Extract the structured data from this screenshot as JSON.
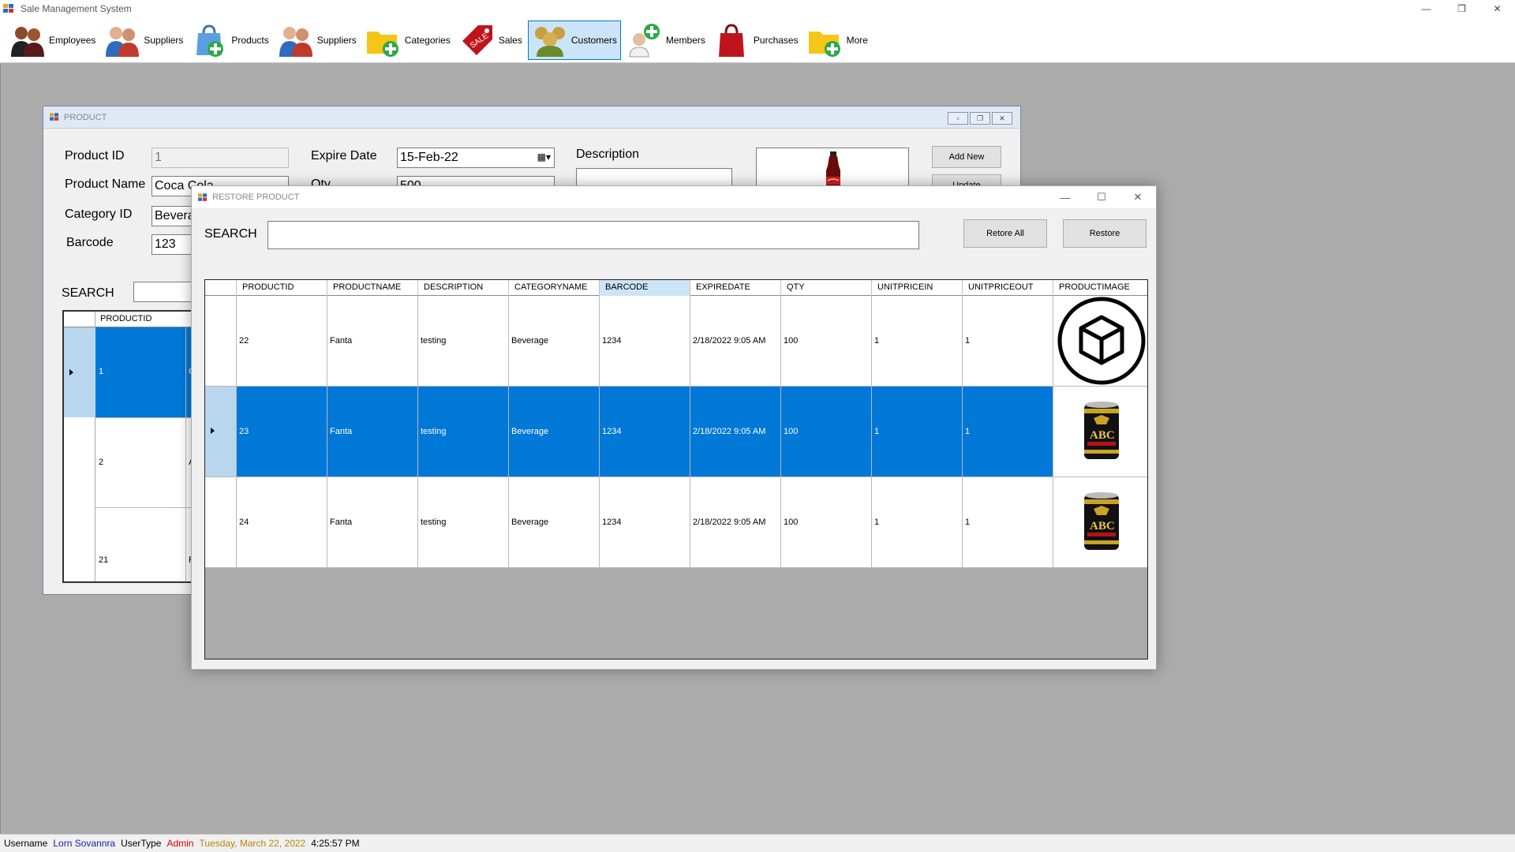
{
  "window": {
    "title": "Sale Management System"
  },
  "toolbar": {
    "items": [
      {
        "label": "Employees",
        "icon": "employees-icon"
      },
      {
        "label": "Suppliers",
        "icon": "suppliers-icon"
      },
      {
        "label": "Products",
        "icon": "products-bag-icon"
      },
      {
        "label": "Suppliers",
        "icon": "suppliers-icon"
      },
      {
        "label": "Categories",
        "icon": "folder-add-icon"
      },
      {
        "label": "Sales",
        "icon": "sale-tag-icon"
      },
      {
        "label": "Customers",
        "icon": "customers-icon",
        "active": true
      },
      {
        "label": "Members",
        "icon": "member-add-icon"
      },
      {
        "label": "Purchases",
        "icon": "shopping-bag-icon"
      },
      {
        "label": "More",
        "icon": "folder-add-icon"
      }
    ]
  },
  "product_form": {
    "title": "PRODUCT",
    "product_id_label": "Product ID",
    "product_id_value": "1",
    "product_name_label": "Product Name",
    "product_name_value": "Coca Cola",
    "category_id_label": "Category ID",
    "category_id_value": "Beverage",
    "barcode_label": "Barcode",
    "barcode_value": "123",
    "expire_date_label": "Expire Date",
    "expire_date_value": "15-Feb-22",
    "qty_label": "Qty",
    "qty_value": "500",
    "description_label": "Description",
    "search_label": "SEARCH",
    "add_new_label": "Add New",
    "update_label": "Update",
    "grid_header_productid": "PRODUCTID",
    "grid_rows": [
      {
        "id": "1",
        "name_initial": "C"
      },
      {
        "id": "2",
        "name_initial": "A"
      },
      {
        "id": "21",
        "name_initial": "F"
      }
    ]
  },
  "restore_dialog": {
    "title": "RESTORE PRODUCT",
    "search_label": "SEARCH",
    "search_value": "",
    "restore_all_label": "Retore All",
    "restore_label": "Restore",
    "columns": [
      "PRODUCTID",
      "PRODUCTNAME",
      "DESCRIPTION",
      "CATEGORYNAME",
      "BARCODE",
      "EXPIREDATE",
      "QTY",
      "UNITPRICEIN",
      "UNITPRICEOUT",
      "PRODUCTIMAGE"
    ],
    "rows": [
      {
        "productid": "22",
        "productname": "Fanta",
        "description": "testing",
        "categoryname": "Beverage",
        "barcode": "1234",
        "expiredate": "2/18/2022 9:05 AM",
        "qty": "100",
        "unitpricein": "1",
        "unitpriceout": "1",
        "image": "box-icon"
      },
      {
        "productid": "23",
        "productname": "Fanta",
        "description": "testing",
        "categoryname": "Beverage",
        "barcode": "1234",
        "expiredate": "2/18/2022 9:05 AM",
        "qty": "100",
        "unitpricein": "1",
        "unitpriceout": "1",
        "image": "abc-can-image"
      },
      {
        "productid": "24",
        "productname": "Fanta",
        "description": "testing",
        "categoryname": "Beverage",
        "barcode": "1234",
        "expiredate": "2/18/2022 9:05 AM",
        "qty": "100",
        "unitpricein": "1",
        "unitpriceout": "1",
        "image": "abc-can-image"
      }
    ]
  },
  "statusbar": {
    "username_label": "Username",
    "username_value": "Lorn Sovannra",
    "usertype_label": "UserType",
    "usertype_value": "Admin",
    "date": "Tuesday, March 22, 2022",
    "time": "4:25:57 PM"
  },
  "colors": {
    "selection": "#0078d7",
    "username": "#1a1ab0",
    "usertype": "#d00000",
    "date": "#b8860b"
  }
}
